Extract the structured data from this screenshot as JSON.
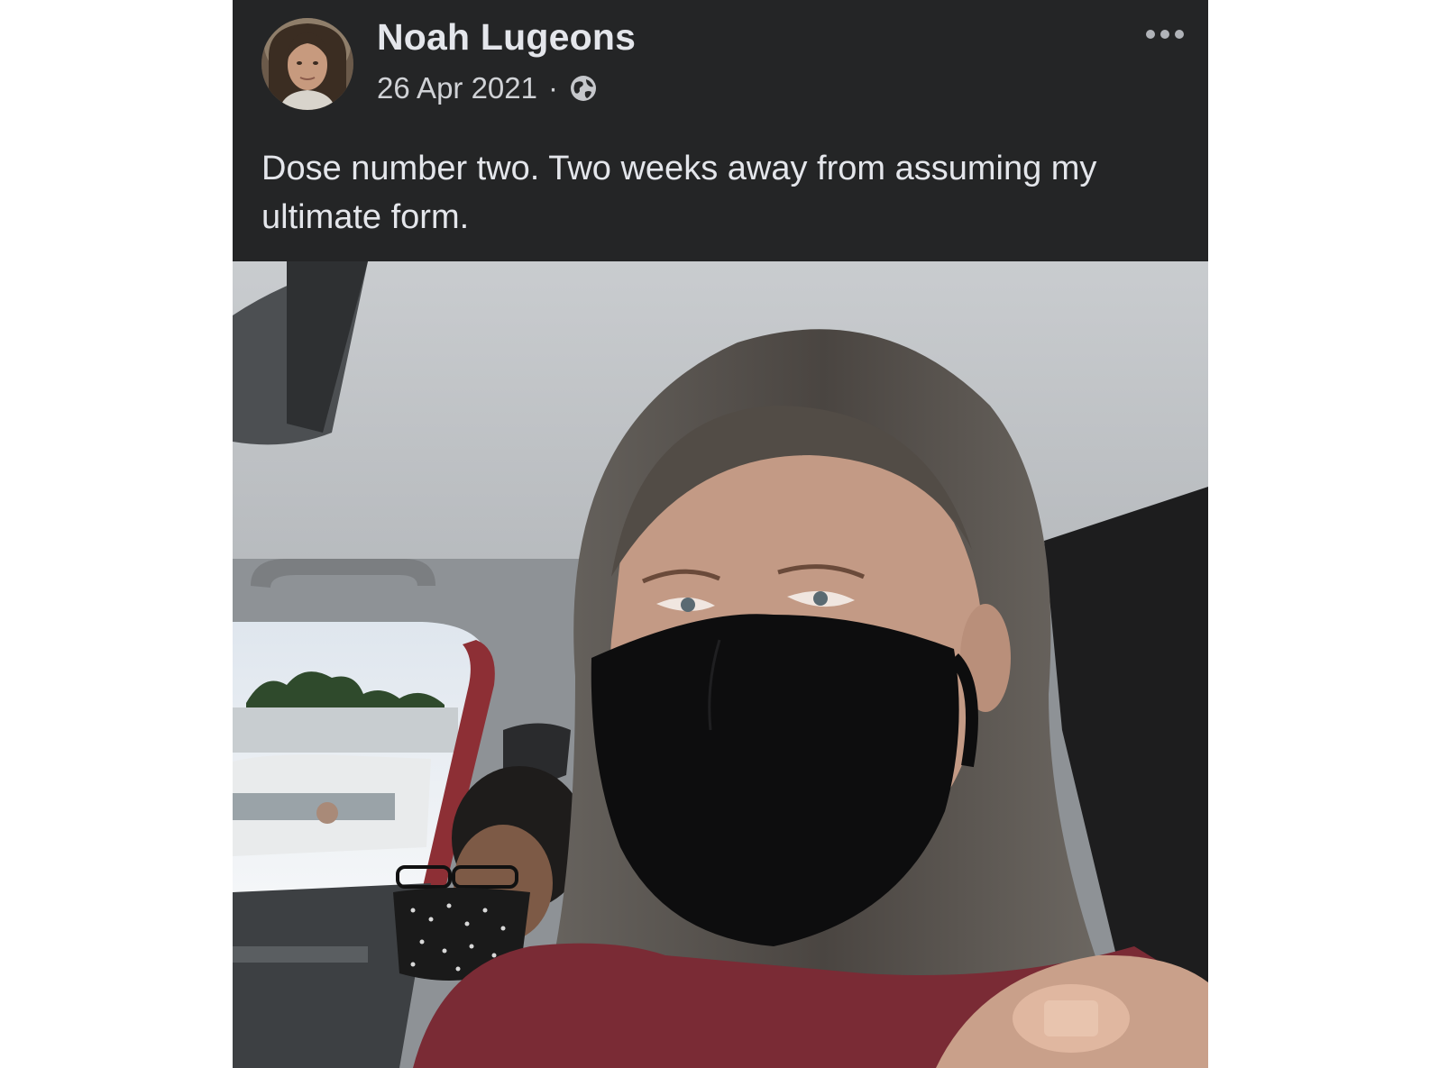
{
  "post": {
    "author_name": "Noah Lugeons",
    "date": "26 Apr 2021",
    "separator": "·",
    "privacy_icon": "globe-icon",
    "more_icon": "more-options-icon",
    "caption": "Dose number two. Two weeks away from assuming my ultimate form."
  },
  "colors": {
    "card_background": "#242526",
    "primary_text": "#e4e6eb",
    "secondary_text": "#d0d2d6"
  }
}
